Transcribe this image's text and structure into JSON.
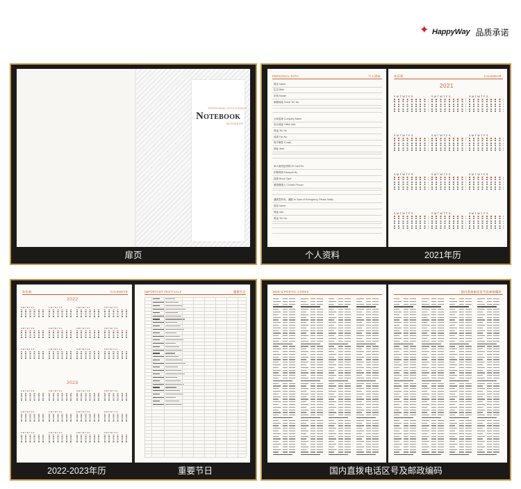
{
  "brand": {
    "name": "HappyWay",
    "slogan": "品质承诺",
    "accent_color": "#d61f26",
    "star_icon": "star-icon"
  },
  "frame_color": "#c49a4e",
  "panels": [
    {
      "caption": "扉页",
      "cover": {
        "label_top": "PERSONAL EFFICIENCY",
        "title_initial": "N",
        "title_rest": "OTEBOOK",
        "label_bottom": "BUSINESS"
      }
    },
    {
      "caption_left": "个人资料",
      "caption_right": "2021年历",
      "personal_header_left": "PERSONAL DATA",
      "personal_header_right": "个人资料",
      "personal_fields": [
        "姓名 Name",
        "生日 Birth",
        "手机 Mobile",
        "家庭地址 Home Tel. No.",
        "公司名称 Company Name",
        "办公地址 Office Add.",
        "电话 Tel. No.",
        "传真 Fax No.",
        "电子邮件 E-mail",
        "网址 Web.",
        "本人身份证号码 ID Card No.",
        "护照号码 Passport No.",
        "血型 Blood Type",
        "紧急联络人 Contact Person",
        "遇到意外时，通知 In Case of Emergency, Please Notify",
        "姓名 Name",
        "地址 Add.",
        "电话 Tel. No."
      ],
      "calendar_header_left": "年历表",
      "calendar_header_right": "CALENDAR",
      "calendar_year": "2021",
      "weekday_letters": "SMTWTFS"
    },
    {
      "caption_left": "2022-2023年历",
      "caption_right": "重要节日",
      "calendar_header_left": "年历表",
      "calendar_header_right": "CALENDAR",
      "calendar_years": [
        "2022",
        "2023"
      ],
      "festival_header_left": "IMPORTANT FESTIVALS",
      "festival_header_right": "重要节日"
    },
    {
      "caption": "国内直拨电话区号及邮政编码",
      "header_left": "DDD & POSTAL CODES",
      "header_right": "国内直拨电话区号及邮政编码"
    }
  ]
}
